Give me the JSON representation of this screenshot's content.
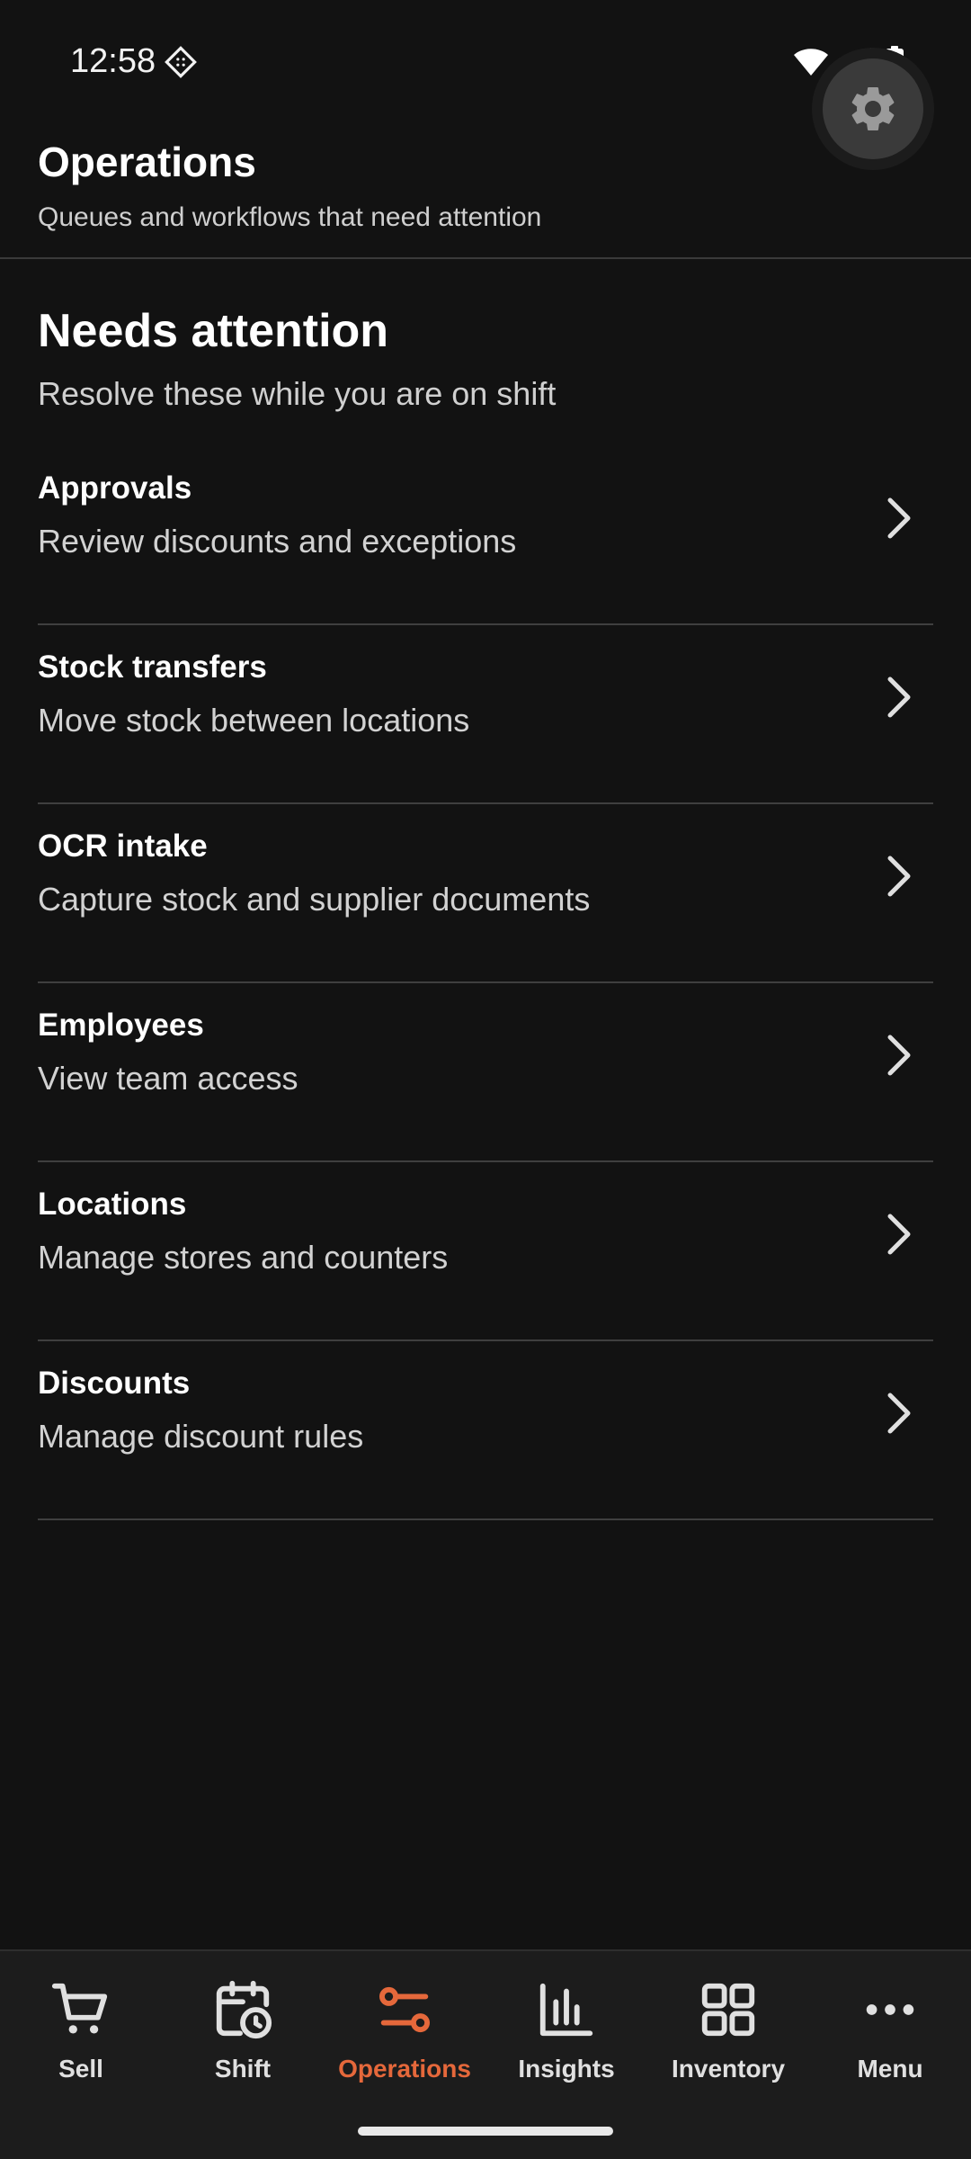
{
  "status_bar": {
    "time": "12:58",
    "icons": [
      "do-not-disturb-icon",
      "wifi-icon",
      "signal-icon",
      "battery-icon"
    ]
  },
  "header": {
    "title": "Operations",
    "subtitle": "Queues and workflows that need attention",
    "settings_icon": "gear-icon"
  },
  "section": {
    "title": "Needs attention",
    "subtitle": "Resolve these while you are on shift"
  },
  "items": [
    {
      "title": "Approvals",
      "description": "Review discounts and exceptions"
    },
    {
      "title": "Stock transfers",
      "description": "Move stock between locations"
    },
    {
      "title": "OCR intake",
      "description": "Capture stock and supplier documents"
    },
    {
      "title": "Employees",
      "description": "View team access"
    },
    {
      "title": "Locations",
      "description": "Manage stores and counters"
    },
    {
      "title": "Discounts",
      "description": "Manage discount rules"
    }
  ],
  "nav": [
    {
      "label": "Sell",
      "icon": "cart-icon",
      "active": false
    },
    {
      "label": "Shift",
      "icon": "calendar-clock-icon",
      "active": false
    },
    {
      "label": "Operations",
      "icon": "workflow-icon",
      "active": true
    },
    {
      "label": "Insights",
      "icon": "bar-chart-icon",
      "active": false
    },
    {
      "label": "Inventory",
      "icon": "grid-icon",
      "active": false
    },
    {
      "label": "Menu",
      "icon": "more-horizontal-icon",
      "active": false
    }
  ],
  "colors": {
    "background": "#121212",
    "accent": "#e5683b",
    "nav_background": "#1c1c1c"
  }
}
